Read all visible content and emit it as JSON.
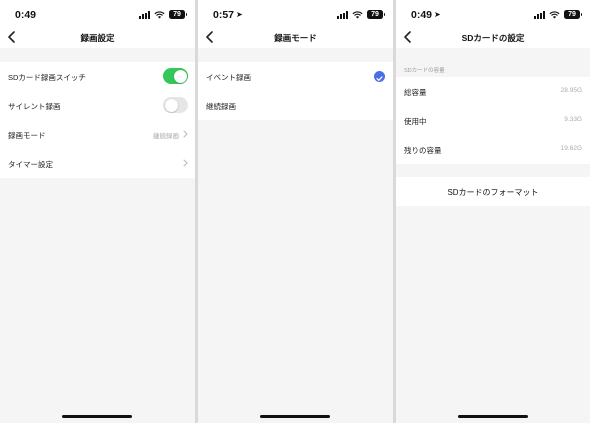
{
  "screens": [
    {
      "status": {
        "time": "0:49",
        "battery": "79"
      },
      "nav": {
        "title": "録画設定"
      },
      "rows": [
        {
          "label": "SDカード録画スイッチ",
          "toggle": "on"
        },
        {
          "label": "サイレント録画",
          "toggle": "off"
        },
        {
          "label": "録画モード",
          "value": "継続録画"
        },
        {
          "label": "タイマー設定"
        }
      ]
    },
    {
      "status": {
        "time": "0:57",
        "battery": "79"
      },
      "nav": {
        "title": "録画モード"
      },
      "rows": [
        {
          "label": "イベント録画",
          "selected": true
        },
        {
          "label": "継続録画",
          "selected": false
        }
      ]
    },
    {
      "status": {
        "time": "0:49",
        "battery": "79"
      },
      "nav": {
        "title": "SDカードの設定"
      },
      "section_header": "SDカードの容量",
      "rows": [
        {
          "label": "総容量",
          "value": "28.95G"
        },
        {
          "label": "使用中",
          "value": "9.33G"
        },
        {
          "label": "残りの容量",
          "value": "19.62G"
        }
      ],
      "format_button": "SDカードのフォーマット"
    }
  ],
  "colors": {
    "toggle_on": "#34c759",
    "checkmark": "#4b6fe6",
    "background": "#f5f5f5"
  },
  "icons": {
    "back": "chevron-left-icon",
    "disclosure": "chevron-right-icon",
    "location": "location-arrow-icon"
  }
}
